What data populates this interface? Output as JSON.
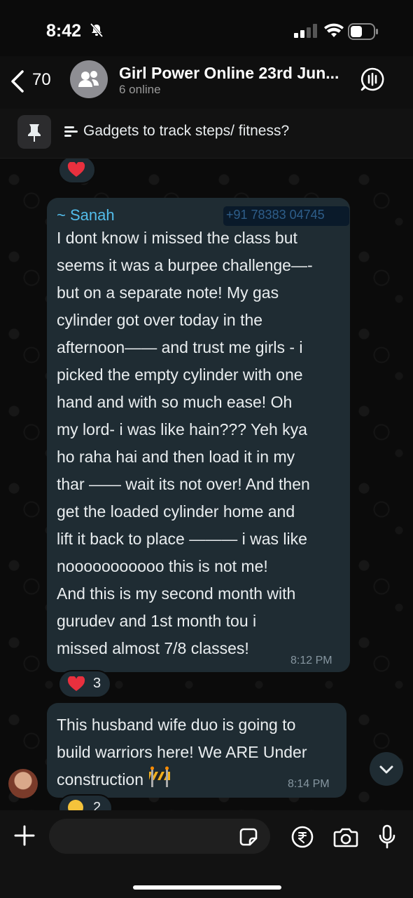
{
  "status_bar": {
    "time": "8:42"
  },
  "header": {
    "back_count": "70",
    "title": "Girl Power Online 23rd Jun...",
    "subtitle": "6 online"
  },
  "pinned": {
    "text": "Gadgets to track steps/ fitness?"
  },
  "messages": [
    {
      "sender": "~ Sanah",
      "phone": "+91 78383 04745",
      "text": "I dont know i missed the class but\nseems it was a burpee challenge—-\nbut on a separate note! My gas\ncylinder got over today in the\nafternoon—— and trust me girls - i\npicked the empty cylinder with one\nhand and with so much ease! Oh\nmy lord- i was like hain??? Yeh kya\nho raha hai and then load it in my\nthar —— wait its not over! And then\nget the loaded cylinder home and\nlift it back to place ——— i was like\nnooooooooooo this is not me!\nAnd this is my second month with\ngurudev and 1st month tou i\nmissed almost 7/8 classes!",
      "time": "8:12 PM",
      "reaction": {
        "emoji": "heart",
        "count": "3"
      }
    },
    {
      "text": "This husband wife duo is going to\nbuild warriors here! We ARE Under\nconstruction",
      "time": "8:14 PM",
      "reaction": {
        "emoji": "laughing",
        "count": "2"
      }
    }
  ],
  "colors": {
    "bubble": "#1f2c33",
    "sender": "#53bdeb",
    "background": "#0b0b0b"
  }
}
